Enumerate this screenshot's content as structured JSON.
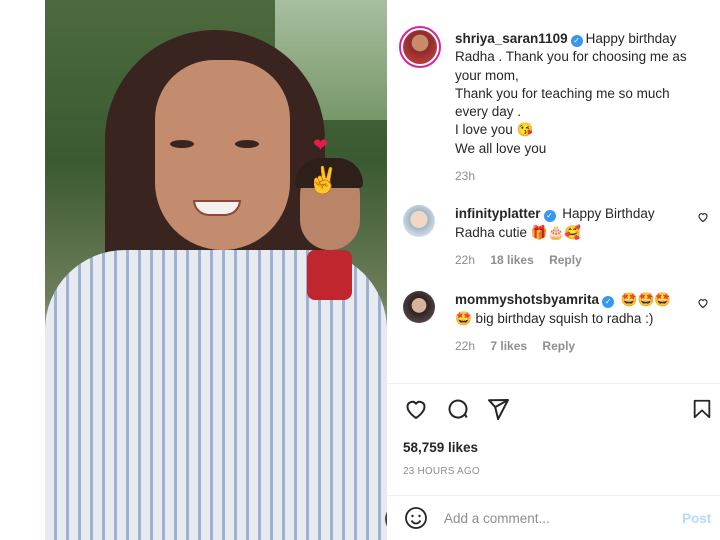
{
  "post": {
    "media": {
      "stickers": [
        "heart-sticker",
        "crossed-fingers-sticker"
      ],
      "mute_icon": "speaker-muted-icon"
    },
    "caption": {
      "username": "shriya_saran1109",
      "verified": true,
      "lines": [
        "Happy birthday Radha . Thank you for choosing me as your mom,",
        "Thank you for teaching me so much every day .",
        "I love you 😘",
        "We all love you"
      ],
      "time": "23h"
    },
    "comments": [
      {
        "username": "infinityplatter",
        "verified": true,
        "text": "Happy Birthday Radha cutie 🎁🎂🥰",
        "time": "22h",
        "likes": "18 likes",
        "reply": "Reply"
      },
      {
        "username": "mommyshotsbyamrita",
        "verified": true,
        "text": "🤩🤩🤩 🤩 big birthday squish to radha :)",
        "time": "22h",
        "likes": "7 likes",
        "reply": "Reply"
      }
    ],
    "actions": {
      "like_icon": "heart-icon",
      "comment_icon": "comment-icon",
      "share_icon": "share-icon",
      "save_icon": "bookmark-icon"
    },
    "likes": "58,759 likes",
    "posted_ago": "23 HOURS AGO",
    "add_comment": {
      "placeholder": "Add a comment...",
      "post_label": "Post"
    }
  },
  "colors": {
    "verified": "#3897f0",
    "muted_text": "#8e8e8e",
    "post_button": "#b3dbff"
  }
}
